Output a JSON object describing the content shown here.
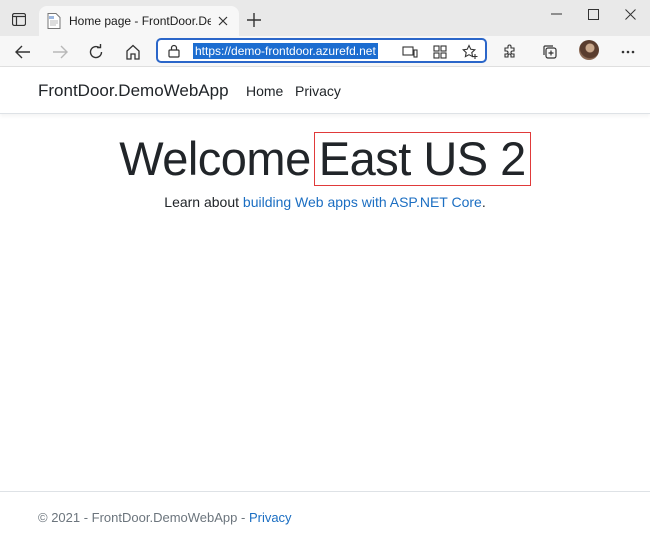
{
  "browser": {
    "tab": {
      "title": "Home page - FrontDoor.DemoW"
    },
    "address": {
      "url": "https://demo-frontdoor.azurefd.net"
    },
    "accent": "#1c6dd0"
  },
  "site": {
    "brand": "FrontDoor.DemoWebApp",
    "nav": [
      "Home",
      "Privacy"
    ],
    "welcome": "Welcome",
    "region": "East US 2",
    "lead_prefix": "Learn about ",
    "lead_link": "building Web apps with ASP.NET Core",
    "lead_suffix": ".",
    "footer_text": "© 2021 - FrontDoor.DemoWebApp - ",
    "footer_link": "Privacy",
    "link_color": "#1b6ec2",
    "highlight_color": "#e03a3a"
  }
}
